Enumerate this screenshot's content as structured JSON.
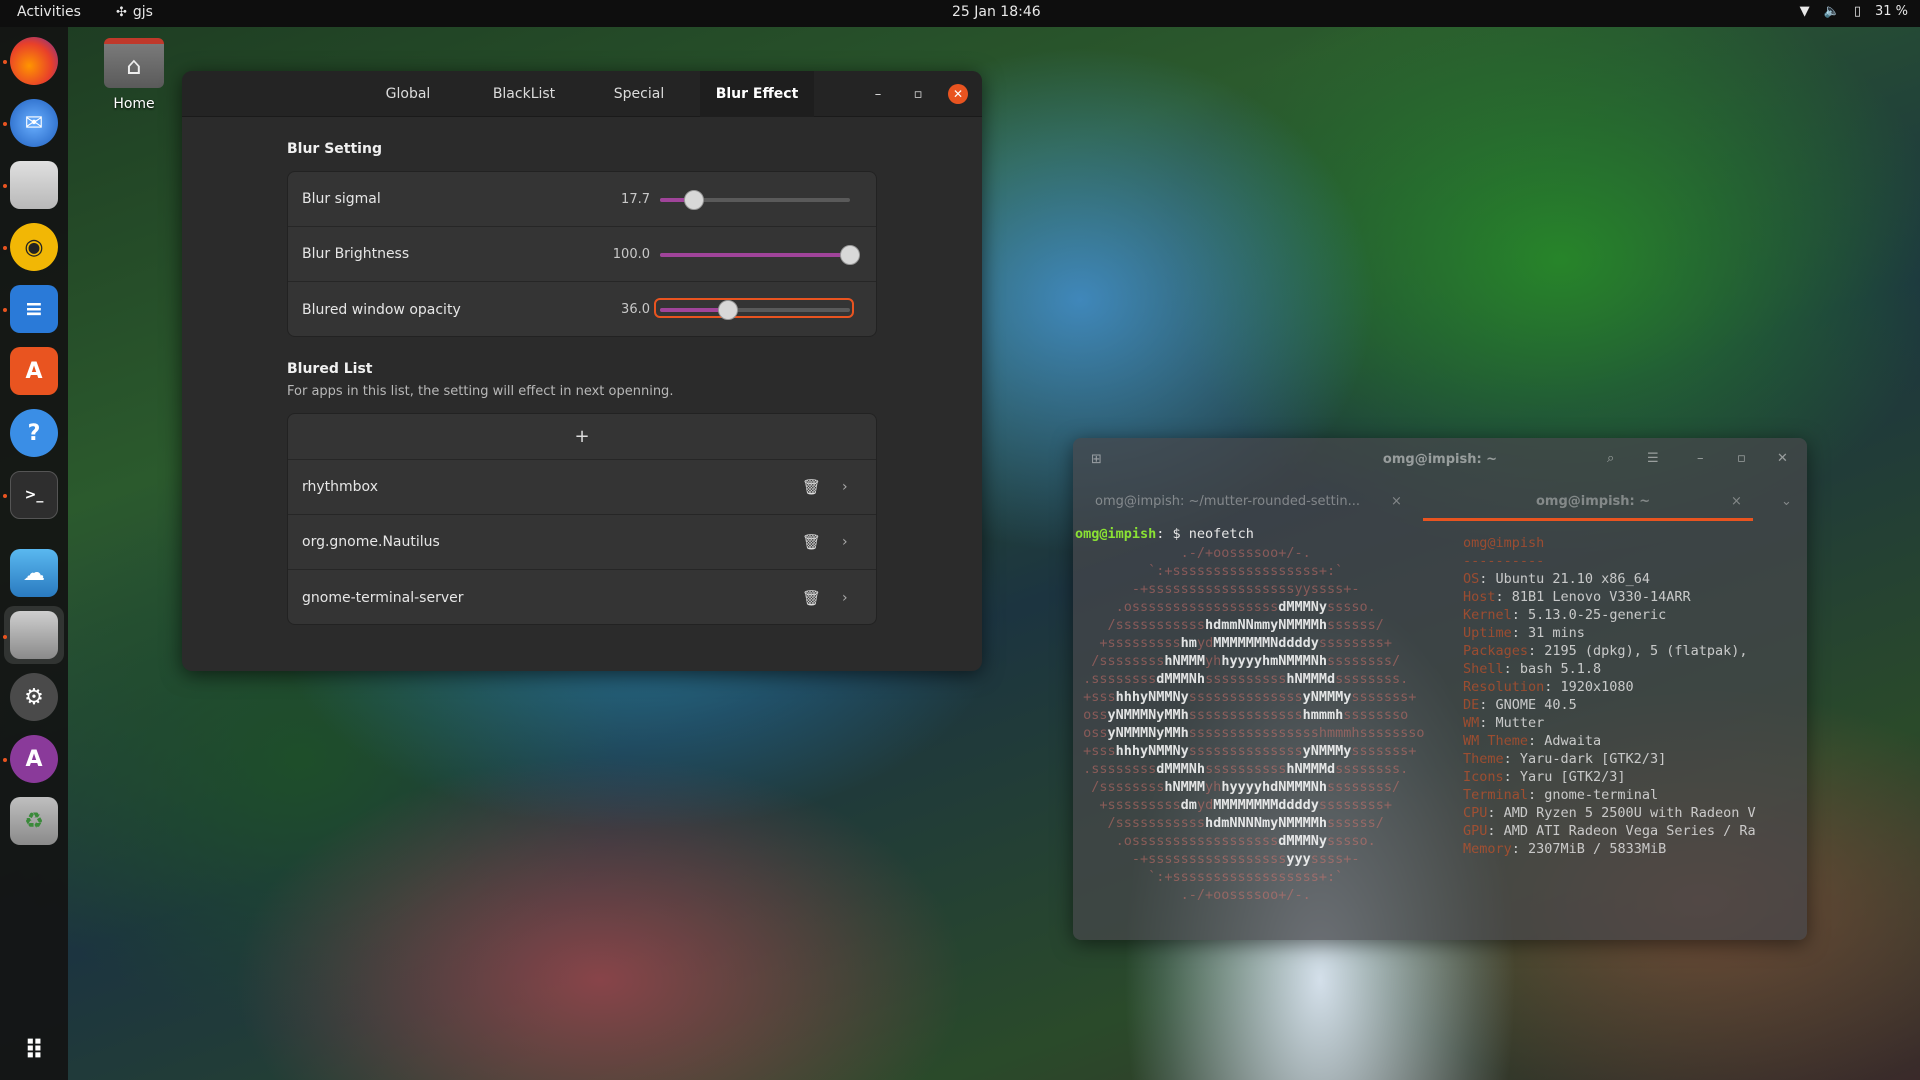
{
  "topbar": {
    "activities": "Activities",
    "app_name": "gjs",
    "clock": "25 Jan  18:46",
    "battery": "31 %"
  },
  "desktop": {
    "home_label": "Home"
  },
  "dock": {
    "items": [
      "firefox-icon",
      "thunderbird-icon",
      "files-icon",
      "rhythmbox-icon",
      "writer-icon",
      "software-icon",
      "help-icon",
      "terminal-icon",
      "weather-icon",
      "gjs-app-icon",
      "settings-icon",
      "extension-icon",
      "trash-icon"
    ],
    "show_apps": "show-apps-icon"
  },
  "settings_window": {
    "tabs": [
      "Global",
      "BlackList",
      "Special",
      "Blur Effect"
    ],
    "active_tab": "Blur Effect",
    "blur_setting": {
      "title": "Blur Setting",
      "rows": [
        {
          "label": "Blur sigmal",
          "value": "17.7",
          "fraction": 0.18
        },
        {
          "label": "Blur Brightness",
          "value": "100.0",
          "fraction": 1.0
        },
        {
          "label": "Blured window opacity",
          "value": "36.0",
          "fraction": 0.36
        }
      ]
    },
    "blured_list": {
      "title": "Blured List",
      "subtitle": "For apps in this list, the setting will effect in next openning.",
      "add_label": "+",
      "items": [
        "rhythmbox",
        "org.gnome.Nautilus",
        "gnome-terminal-server"
      ]
    },
    "accent_color": "#e95420",
    "slider_color": "#a0449a"
  },
  "terminal": {
    "title": "omg@impish: ~",
    "tabs": [
      "omg@impish: ~/mutter-rounded-settin...",
      "omg@impish: ~"
    ],
    "prompt_user": "omg@impish",
    "prompt_path": ": $ ",
    "command": "neofetch",
    "ascii": [
      [
        "             .-/+oossssoo+/-.",
        ""
      ],
      [
        "         `:+ssssssssssssssssss+:`",
        ""
      ],
      [
        "       -+ssssssssssssssssssyyssss+-",
        ""
      ],
      [
        "     .ossssssssssssssssss",
        "dMMMNy",
        "sssso."
      ],
      [
        "    /sssssssssss",
        "hdmmNNmmyNMMMMh",
        "ssssss/"
      ],
      [
        "   +sssssssss",
        "hm",
        "yd",
        "MMMMMMMNddddy",
        "ssssssss+"
      ],
      [
        "  /ssssssss",
        "hNMMM",
        "yh",
        "hyyyyhmNMMMNh",
        "ssssssss/"
      ],
      [
        " .ssssssss",
        "dMMMNh",
        "ssssssssss",
        "hNMMMd",
        "ssssssss."
      ],
      [
        " +sss",
        "hhhyNMMNy",
        "ssssssssssssss",
        "yNMMMy",
        "sssssss+"
      ],
      [
        " oss",
        "yNMMMNyMMh",
        "ssssssssssssss",
        "hmmmh",
        "ssssssso"
      ],
      [
        " oss",
        "yNMMMNyMMh",
        "sssssssssssssssshmmmhssssssso"
      ],
      [
        " +sss",
        "hhhyNMMNy",
        "ssssssssssssss",
        "yNMMMy",
        "sssssss+"
      ],
      [
        " .ssssssss",
        "dMMMNh",
        "ssssssssss",
        "hNMMMd",
        "ssssssss."
      ],
      [
        "  /ssssssss",
        "hNMMM",
        "yh",
        "hyyyyhdNMMMNh",
        "ssssssss/"
      ],
      [
        "   +sssssssss",
        "dm",
        "yd",
        "MMMMMMMMddddy",
        "ssssssss+"
      ],
      [
        "    /sssssssssss",
        "hdmNNNNmyNMMMMh",
        "ssssss/"
      ],
      [
        "     .ossssssssssssssssss",
        "dMMMNy",
        "sssso."
      ],
      [
        "       -+sssssssssssssssss",
        "yyy",
        "ssss+-"
      ],
      [
        "         `:+ssssssssssssssssss+:`",
        ""
      ],
      [
        "             .-/+oossssoo+/-.",
        ""
      ]
    ],
    "info_header": "omg@impish",
    "info_sep": "----------",
    "info": [
      {
        "k": "OS",
        "v": "Ubuntu 21.10 x86_64"
      },
      {
        "k": "Host",
        "v": "81B1 Lenovo V330-14ARR"
      },
      {
        "k": "Kernel",
        "v": "5.13.0-25-generic"
      },
      {
        "k": "Uptime",
        "v": "31 mins"
      },
      {
        "k": "Packages",
        "v": "2195 (dpkg), 5 (flatpak),"
      },
      {
        "k": "Shell",
        "v": "bash 5.1.8"
      },
      {
        "k": "Resolution",
        "v": "1920x1080"
      },
      {
        "k": "DE",
        "v": "GNOME 40.5"
      },
      {
        "k": "WM",
        "v": "Mutter"
      },
      {
        "k": "WM Theme",
        "v": "Adwaita"
      },
      {
        "k": "Theme",
        "v": "Yaru-dark [GTK2/3]"
      },
      {
        "k": "Icons",
        "v": "Yaru [GTK2/3]"
      },
      {
        "k": "Terminal",
        "v": "gnome-terminal"
      },
      {
        "k": "CPU",
        "v": "AMD Ryzen 5 2500U with Radeon V"
      },
      {
        "k": "GPU",
        "v": "AMD ATI Radeon Vega Series / Ra"
      },
      {
        "k": "Memory",
        "v": "2307MiB / 5833MiB"
      }
    ],
    "swatches": [
      "#3a4a3a",
      "#7a6a3a",
      "#3a8a3a",
      "#6a8a2a",
      "#2a7a6a",
      "#4a6a5a",
      "#3a9a5a",
      "#6aba7a"
    ]
  }
}
